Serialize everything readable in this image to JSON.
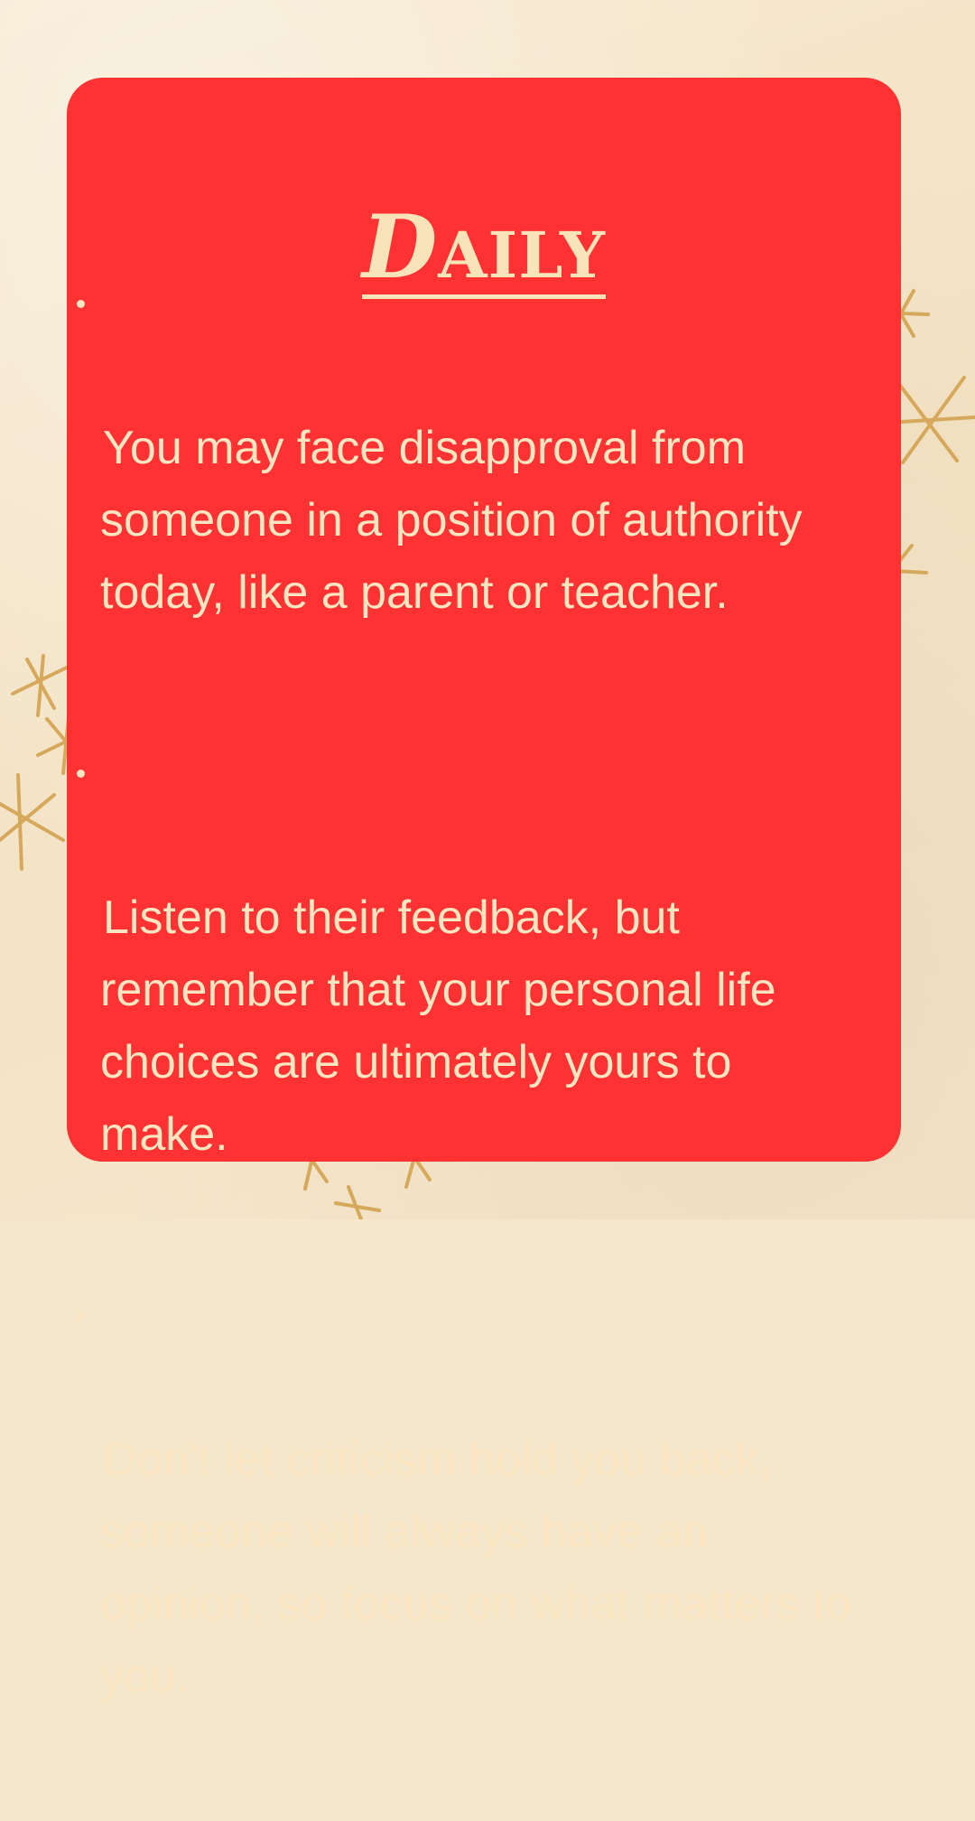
{
  "title": {
    "initial": "D",
    "rest": "AILY"
  },
  "bullets": [
    {
      "text": "You may face disapproval from\nsomeone in a position of authority\ntoday, like a parent or teacher."
    },
    {
      "text": "Listen to their feedback, but\nremember that your personal life\nchoices are ultimately yours to\nmake."
    },
    {
      "text": "Don't let criticism hold you back;\nsomeone will always have an\nopinion, so focus on what matters to\nyou."
    }
  ],
  "colors": {
    "background": "#f5e7cc",
    "card": "#fe3232",
    "text": "#fbe6c2",
    "sparkle": "#d6a85c"
  },
  "decorations": [
    "sparkle-icon"
  ]
}
